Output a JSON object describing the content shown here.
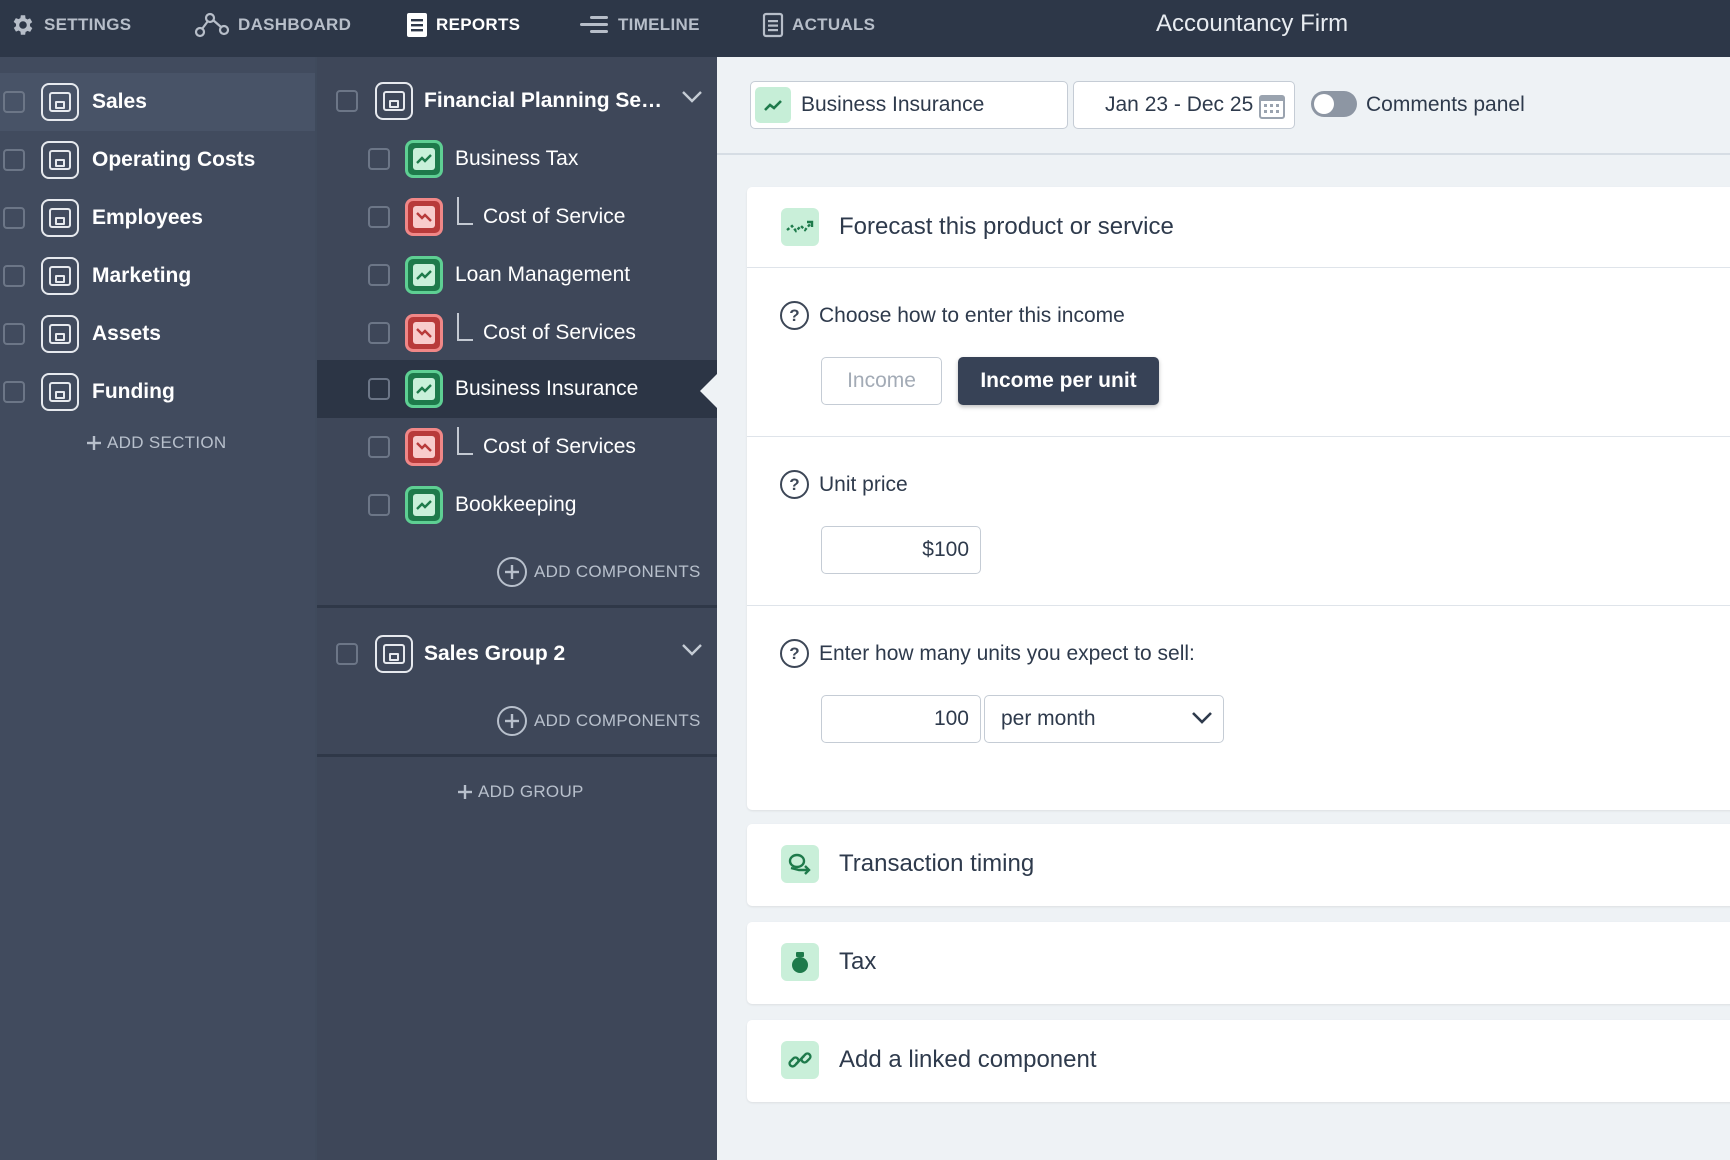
{
  "nav": {
    "settings": "SETTINGS",
    "dashboard": "DASHBOARD",
    "reports": "REPORTS",
    "timeline": "TIMELINE",
    "actuals": "ACTUALS"
  },
  "app_title": "Accountancy Firm",
  "sections": {
    "items": [
      {
        "label": "Sales"
      },
      {
        "label": "Operating Costs"
      },
      {
        "label": "Employees"
      },
      {
        "label": "Marketing"
      },
      {
        "label": "Assets"
      },
      {
        "label": "Funding"
      }
    ],
    "add_label": "ADD SECTION"
  },
  "groups": [
    {
      "label": "Financial Planning Ser...",
      "components": [
        {
          "label": "Business Tax",
          "kind": "income"
        },
        {
          "label": "Cost of Service",
          "kind": "cost"
        },
        {
          "label": "Loan Management",
          "kind": "income"
        },
        {
          "label": "Cost of Services",
          "kind": "cost"
        },
        {
          "label": "Business Insurance",
          "kind": "income"
        },
        {
          "label": "Cost of Services",
          "kind": "cost"
        },
        {
          "label": "Bookkeeping",
          "kind": "income"
        }
      ],
      "add_label": "ADD COMPONENTS"
    },
    {
      "label": "Sales Group 2",
      "components": [],
      "add_label": "ADD COMPONENTS"
    }
  ],
  "add_group_label": "ADD GROUP",
  "toolbar": {
    "component_name": "Business Insurance",
    "date_range": "Jan 23 - Dec 25",
    "comments_label": "Comments panel",
    "comments_on": false
  },
  "forecast": {
    "title": "Forecast this product or service",
    "choose_label": "Choose how to enter this income",
    "options": [
      "Income",
      "Income per unit"
    ],
    "selected_option": "Income per unit",
    "unit_price_label": "Unit price",
    "unit_price_value": "$100",
    "units_label": "Enter how many units you expect to sell:",
    "units_value": "100",
    "frequency": "per month"
  },
  "panels": {
    "transaction_timing": "Transaction timing",
    "tax": "Tax",
    "linked": "Add a linked component"
  },
  "colors": {
    "nav_bg": "#2d3748",
    "selected_bg": "#2c3545",
    "income_green": "#5ecf93",
    "cost_red": "#f08787",
    "primary_button": "#374256"
  }
}
